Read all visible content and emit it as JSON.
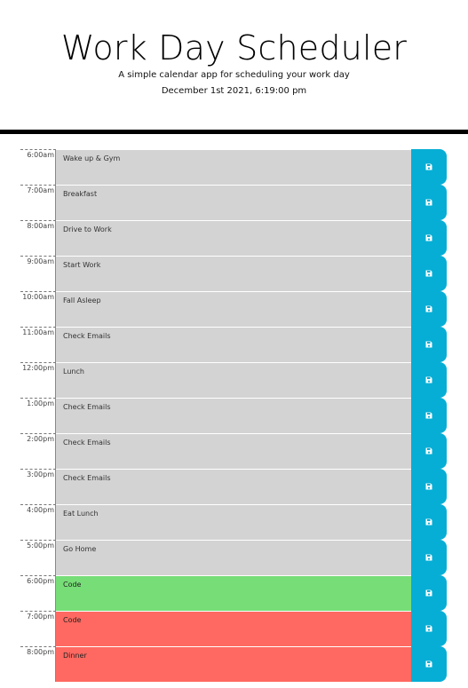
{
  "header": {
    "title": "Work Day Scheduler",
    "subtitle": "A simple calendar app for scheduling your work day",
    "current_day": "December 1st 2021, 6:19:00 pm"
  },
  "rows": [
    {
      "hour": "6:00am",
      "text": "Wake up & Gym",
      "state": "past"
    },
    {
      "hour": "7:00am",
      "text": "Breakfast",
      "state": "past"
    },
    {
      "hour": "8:00am",
      "text": "Drive to Work",
      "state": "past"
    },
    {
      "hour": "9:00am",
      "text": "Start Work",
      "state": "past"
    },
    {
      "hour": "10:00am",
      "text": "Fall Asleep",
      "state": "past"
    },
    {
      "hour": "11:00am",
      "text": "Check Emails",
      "state": "past"
    },
    {
      "hour": "12:00pm",
      "text": "Lunch",
      "state": "past"
    },
    {
      "hour": "1:00pm",
      "text": "Check Emails",
      "state": "past"
    },
    {
      "hour": "2:00pm",
      "text": "Check Emails",
      "state": "past"
    },
    {
      "hour": "3:00pm",
      "text": "Check Emails",
      "state": "past"
    },
    {
      "hour": "4:00pm",
      "text": "Eat Lunch",
      "state": "past"
    },
    {
      "hour": "5:00pm",
      "text": "Go Home",
      "state": "past"
    },
    {
      "hour": "6:00pm",
      "text": "Code",
      "state": "present"
    },
    {
      "hour": "7:00pm",
      "text": "Code",
      "state": "future"
    },
    {
      "hour": "8:00pm",
      "text": "Dinner",
      "state": "future"
    }
  ],
  "save_icon": "save-icon",
  "colors": {
    "past": "#d3d3d3",
    "present": "#77dd77",
    "future": "#ff6961",
    "save_button": "#06aed5"
  }
}
